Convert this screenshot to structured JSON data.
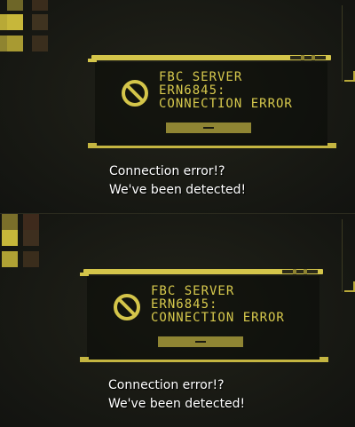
{
  "panels": [
    {
      "dialog": {
        "title": "FBC SERVER",
        "code": "ERN6845:",
        "message": "CONNECTION ERROR",
        "icon": "prohibited-icon"
      },
      "subtitle": {
        "line1": "Connection error!?",
        "line2": "We've been detected!"
      }
    },
    {
      "dialog": {
        "title": "FBC SERVER",
        "code": "ERN6845:",
        "message": "CONNECTION ERROR",
        "icon": "prohibited-icon"
      },
      "subtitle": {
        "line1": "Connection error!?",
        "line2": "We've been detected!"
      }
    }
  ],
  "colors": {
    "accent": "#d4c54a",
    "text": "#d7c94d",
    "subtitle": "#ffffff",
    "background": "#161711"
  }
}
